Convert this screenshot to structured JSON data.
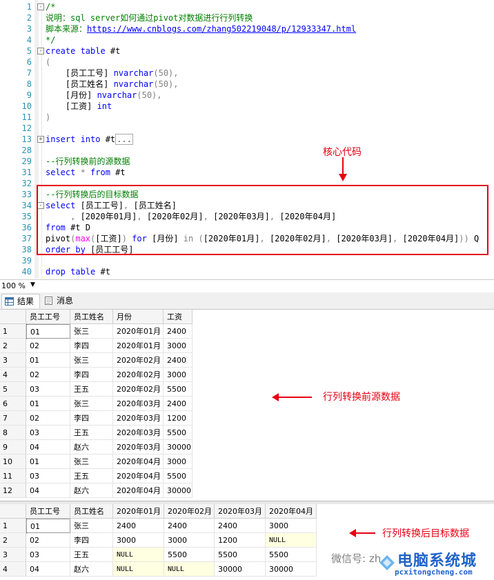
{
  "editor": {
    "lines": [
      {
        "n": "1",
        "fold": "-",
        "segs": [
          {
            "c": "cm",
            "t": "/*"
          }
        ]
      },
      {
        "n": "2",
        "segs": [
          {
            "c": "cm",
            "t": "说明：sql server如何通过pivot对数据进行行列转换"
          }
        ]
      },
      {
        "n": "3",
        "segs": [
          {
            "c": "cm",
            "t": "脚本来源："
          },
          {
            "c": "url",
            "t": "https://www.cnblogs.com/zhang502219048/p/12933347.html"
          }
        ]
      },
      {
        "n": "4",
        "segs": [
          {
            "c": "cm",
            "t": "*/"
          }
        ]
      },
      {
        "n": "5",
        "fold": "-",
        "segs": [
          {
            "c": "kw",
            "t": "create table"
          },
          {
            "c": "",
            "t": " #t"
          }
        ]
      },
      {
        "n": "6",
        "segs": [
          {
            "c": "gr",
            "t": "("
          }
        ]
      },
      {
        "n": "7",
        "segs": [
          {
            "c": "",
            "t": "    [员工工号] "
          },
          {
            "c": "kw",
            "t": "nvarchar"
          },
          {
            "c": "gr",
            "t": "(50),"
          }
        ]
      },
      {
        "n": "8",
        "segs": [
          {
            "c": "",
            "t": "    [员工姓名] "
          },
          {
            "c": "kw",
            "t": "nvarchar"
          },
          {
            "c": "gr",
            "t": "(50),"
          }
        ]
      },
      {
        "n": "9",
        "segs": [
          {
            "c": "",
            "t": "    [月份] "
          },
          {
            "c": "kw",
            "t": "nvarchar"
          },
          {
            "c": "gr",
            "t": "(50),"
          }
        ]
      },
      {
        "n": "10",
        "segs": [
          {
            "c": "",
            "t": "    [工资] "
          },
          {
            "c": "kw",
            "t": "int"
          }
        ]
      },
      {
        "n": "11",
        "segs": [
          {
            "c": "gr",
            "t": ")"
          }
        ]
      },
      {
        "n": "12",
        "segs": []
      },
      {
        "n": "13",
        "fold": "+",
        "segs": [
          {
            "c": "kw",
            "t": "insert into"
          },
          {
            "c": "",
            "t": " #t"
          },
          {
            "c": "collapsed",
            "t": "..."
          }
        ]
      },
      {
        "n": "28",
        "segs": []
      },
      {
        "n": "29",
        "segs": [
          {
            "c": "cm",
            "t": "--行列转换前的源数据"
          }
        ]
      },
      {
        "n": "31",
        "segs": [
          {
            "c": "kw",
            "t": "select"
          },
          {
            "c": "gr",
            "t": " * "
          },
          {
            "c": "kw",
            "t": "from"
          },
          {
            "c": "",
            "t": " #t"
          }
        ]
      },
      {
        "n": "32",
        "segs": []
      },
      {
        "n": "33",
        "segs": [
          {
            "c": "cm",
            "t": "--行列转换后的目标数据"
          }
        ]
      },
      {
        "n": "34",
        "fold": "-",
        "segs": [
          {
            "c": "kw",
            "t": "select"
          },
          {
            "c": "",
            "t": " [员工工号]"
          },
          {
            "c": "gr",
            "t": ", "
          },
          {
            "c": "",
            "t": "[员工姓名]"
          }
        ]
      },
      {
        "n": "35",
        "segs": [
          {
            "c": "gr",
            "t": "     , "
          },
          {
            "c": "",
            "t": "[2020年01月]"
          },
          {
            "c": "gr",
            "t": ", "
          },
          {
            "c": "",
            "t": "[2020年02月]"
          },
          {
            "c": "gr",
            "t": ", "
          },
          {
            "c": "",
            "t": "[2020年03月]"
          },
          {
            "c": "gr",
            "t": ", "
          },
          {
            "c": "",
            "t": "[2020年04月]"
          }
        ]
      },
      {
        "n": "36",
        "segs": [
          {
            "c": "kw",
            "t": "from"
          },
          {
            "c": "",
            "t": " #t D"
          }
        ]
      },
      {
        "n": "37",
        "segs": [
          {
            "c": "",
            "t": "pivot"
          },
          {
            "c": "gr",
            "t": "("
          },
          {
            "c": "fn",
            "t": "max"
          },
          {
            "c": "gr",
            "t": "("
          },
          {
            "c": "",
            "t": "[工资]"
          },
          {
            "c": "gr",
            "t": ") "
          },
          {
            "c": "kw",
            "t": "for"
          },
          {
            "c": "",
            "t": " [月份] "
          },
          {
            "c": "gr",
            "t": "in ("
          },
          {
            "c": "",
            "t": "[2020年01月]"
          },
          {
            "c": "gr",
            "t": ", "
          },
          {
            "c": "",
            "t": "[2020年02月]"
          },
          {
            "c": "gr",
            "t": ", "
          },
          {
            "c": "",
            "t": "[2020年03月]"
          },
          {
            "c": "gr",
            "t": ", "
          },
          {
            "c": "",
            "t": "[2020年04月]"
          },
          {
            "c": "gr",
            "t": ")) "
          },
          {
            "c": "",
            "t": "Q"
          }
        ]
      },
      {
        "n": "38",
        "segs": [
          {
            "c": "kw",
            "t": "order by"
          },
          {
            "c": "",
            "t": " [员工工号]"
          }
        ]
      },
      {
        "n": "39",
        "segs": []
      },
      {
        "n": "40",
        "segs": [
          {
            "c": "kw",
            "t": "drop table"
          },
          {
            "c": "",
            "t": " #t"
          }
        ]
      }
    ]
  },
  "annotations": {
    "core_code": "核心代码",
    "before_data": "行列转换前源数据",
    "after_data": "行列转换后目标数据"
  },
  "zoom": {
    "label": "100 %"
  },
  "tabs": [
    {
      "label": "结果",
      "active": true
    },
    {
      "label": "消息",
      "active": false
    }
  ],
  "source_grid": {
    "columns": [
      "员工工号",
      "员工姓名",
      "月份",
      "工资"
    ],
    "rows": [
      [
        "1",
        "01",
        "张三",
        "2020年01月",
        "2400"
      ],
      [
        "2",
        "02",
        "李四",
        "2020年01月",
        "3000"
      ],
      [
        "3",
        "01",
        "张三",
        "2020年02月",
        "2400"
      ],
      [
        "4",
        "02",
        "李四",
        "2020年02月",
        "3000"
      ],
      [
        "5",
        "03",
        "王五",
        "2020年02月",
        "5500"
      ],
      [
        "6",
        "01",
        "张三",
        "2020年03月",
        "2400"
      ],
      [
        "7",
        "02",
        "李四",
        "2020年03月",
        "1200"
      ],
      [
        "8",
        "03",
        "王五",
        "2020年03月",
        "5500"
      ],
      [
        "9",
        "04",
        "赵六",
        "2020年03月",
        "30000"
      ],
      [
        "10",
        "01",
        "张三",
        "2020年04月",
        "3000"
      ],
      [
        "11",
        "03",
        "王五",
        "2020年04月",
        "5500"
      ],
      [
        "12",
        "04",
        "赵六",
        "2020年04月",
        "30000"
      ]
    ]
  },
  "pivot_grid": {
    "columns": [
      "员工工号",
      "员工姓名",
      "2020年01月",
      "2020年02月",
      "2020年03月",
      "2020年04月"
    ],
    "rows": [
      [
        "1",
        "01",
        "张三",
        "2400",
        "2400",
        "2400",
        "3000"
      ],
      [
        "2",
        "02",
        "李四",
        "3000",
        "3000",
        "1200",
        "NULL"
      ],
      [
        "3",
        "03",
        "王五",
        "NULL",
        "5500",
        "5500",
        "5500"
      ],
      [
        "4",
        "04",
        "赵六",
        "NULL",
        "NULL",
        "30000",
        "30000"
      ]
    ]
  },
  "watermark": {
    "wechat": "微信号: zh",
    "brand": "电脑系统城",
    "domain": "pcxitongcheng.com"
  }
}
